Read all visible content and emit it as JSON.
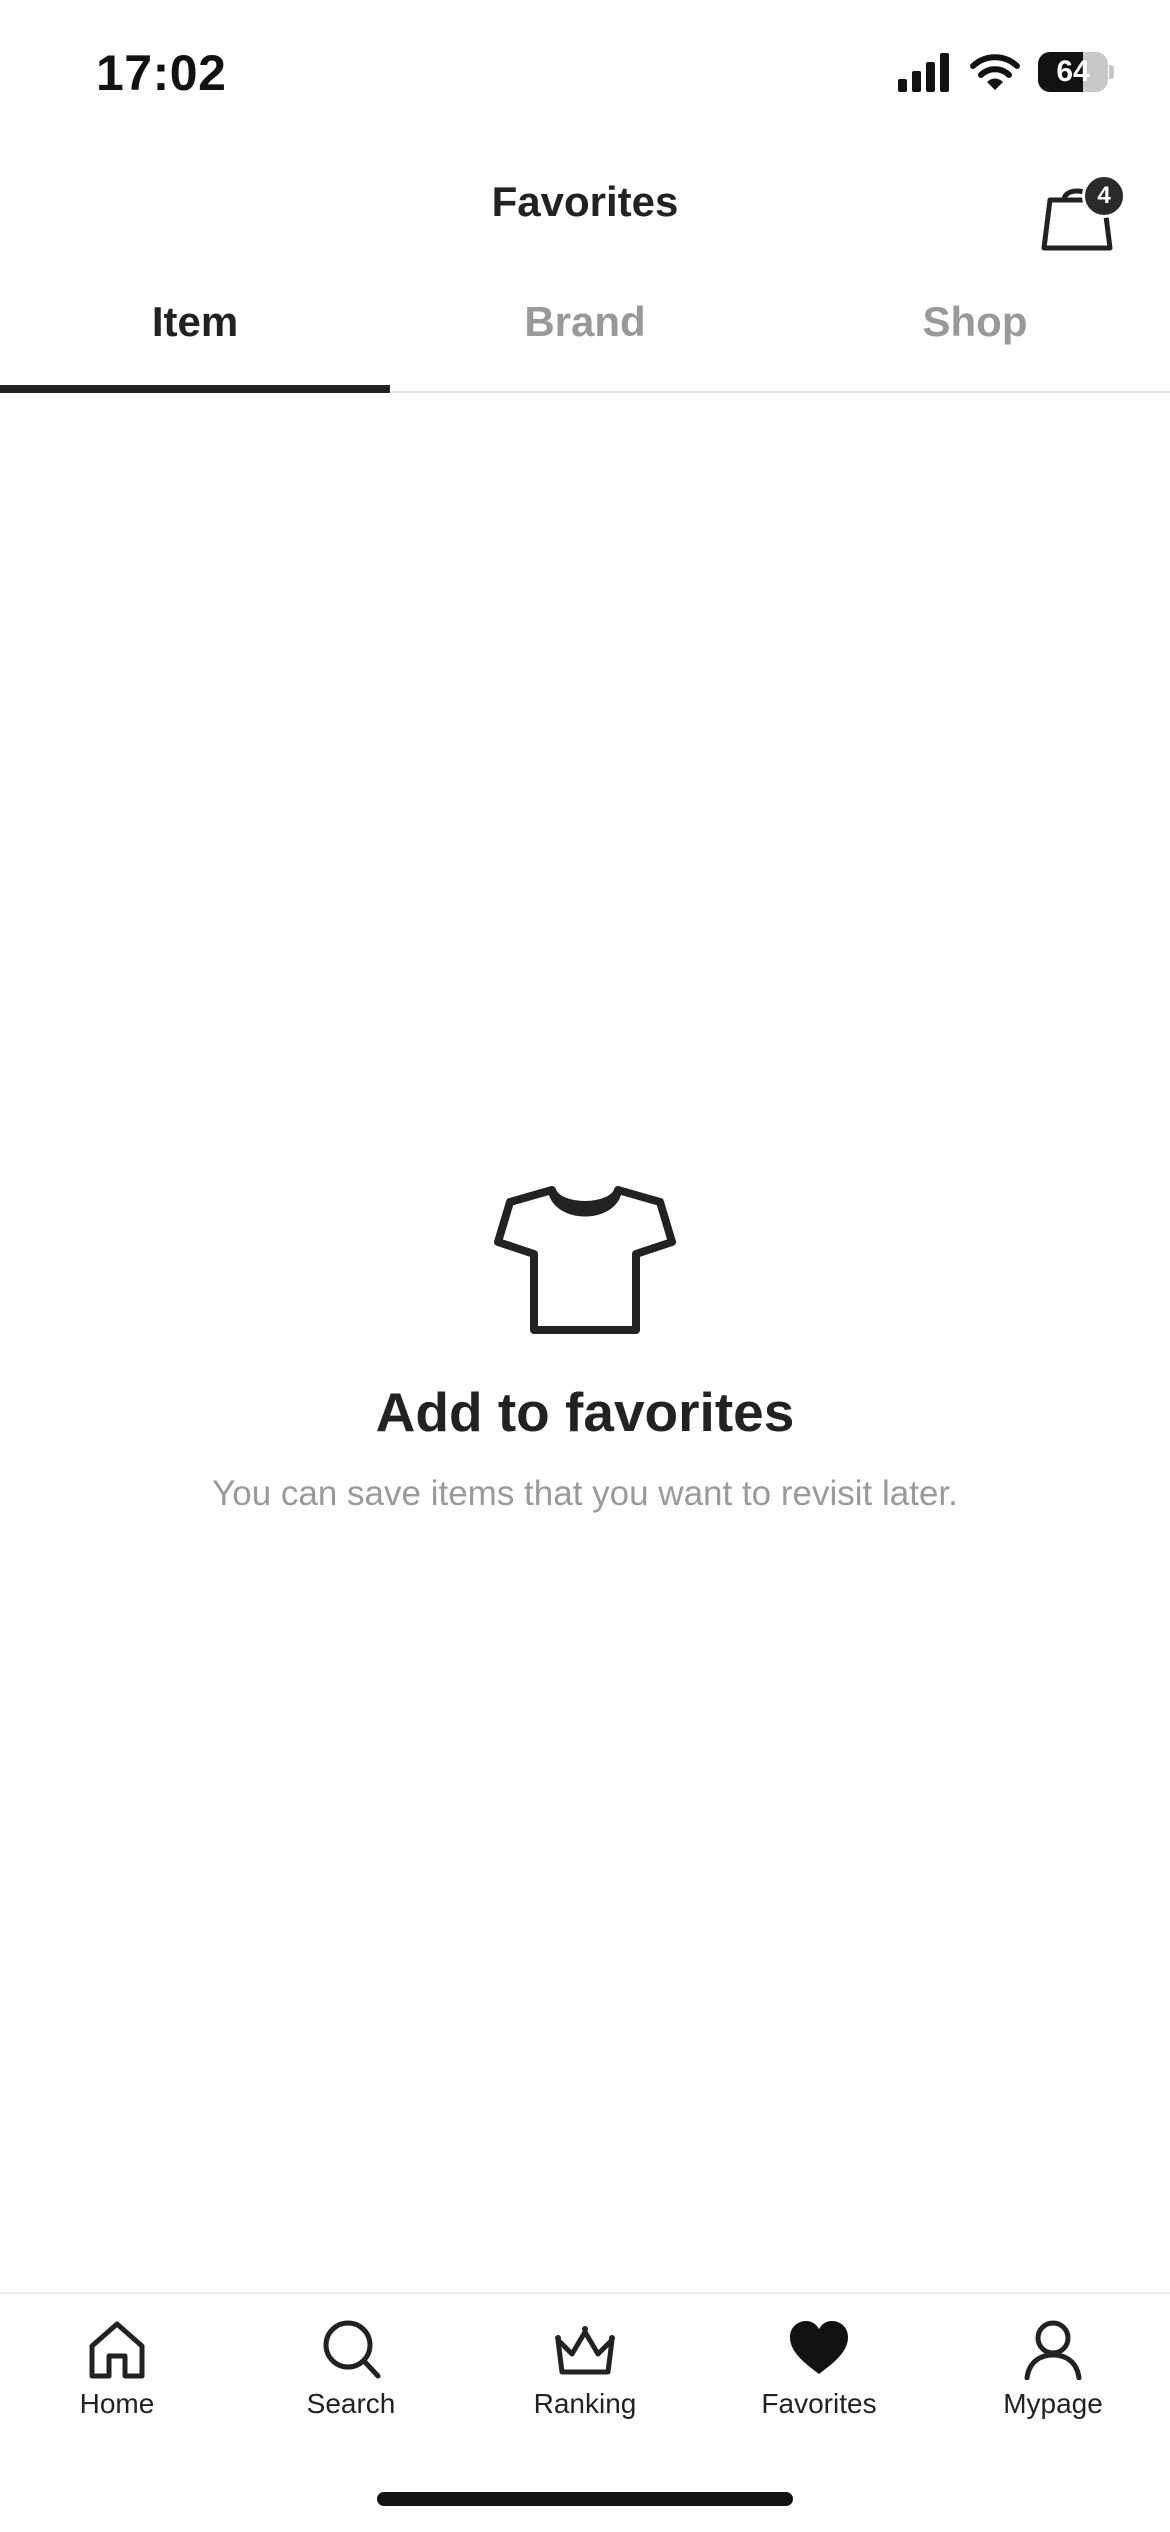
{
  "status_bar": {
    "time": "17:02",
    "battery_level": "64",
    "battery_fraction": 0.64,
    "icons": [
      "signal-icon",
      "wifi-icon",
      "battery-icon"
    ]
  },
  "header": {
    "title": "Favorites",
    "cart_badge": "4",
    "cart_icon": "shopping-bag-icon"
  },
  "tabs": [
    {
      "label": "Item",
      "active": true
    },
    {
      "label": "Brand",
      "active": false
    },
    {
      "label": "Shop",
      "active": false
    }
  ],
  "empty_state": {
    "icon": "tshirt-icon",
    "title": "Add to favorites",
    "subtitle": "You can save items that you want to revisit later."
  },
  "bottom_nav": {
    "items": [
      {
        "label": "Home",
        "icon": "home-icon",
        "active": false
      },
      {
        "label": "Search",
        "icon": "search-icon",
        "active": false
      },
      {
        "label": "Ranking",
        "icon": "crown-icon",
        "active": false
      },
      {
        "label": "Favorites",
        "icon": "heart-icon",
        "active": true
      },
      {
        "label": "Mypage",
        "icon": "person-icon",
        "active": false
      }
    ]
  },
  "colors": {
    "text_primary": "#222222",
    "text_secondary": "#999999",
    "tab_inactive": "#999999",
    "divider": "#e6e6e6",
    "background": "#ffffff"
  }
}
